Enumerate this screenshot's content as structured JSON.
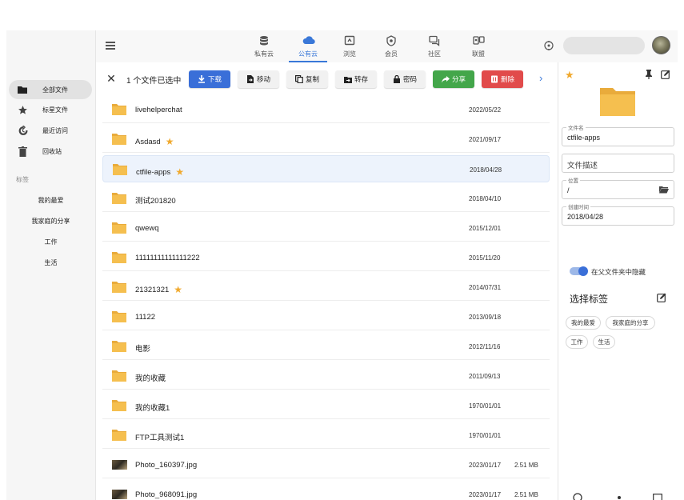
{
  "sidebar": {
    "items": [
      {
        "label": "全部文件",
        "icon": "folder-icon"
      },
      {
        "label": "标星文件",
        "icon": "star-icon"
      },
      {
        "label": "最近访问",
        "icon": "history-icon"
      },
      {
        "label": "回收站",
        "icon": "trash-icon"
      }
    ],
    "tags_title": "标签",
    "tags": [
      "我的最爱",
      "我家庭的分享",
      "工作",
      "生活"
    ]
  },
  "topbar": {
    "tabs": [
      {
        "label": "私有云",
        "icon": "database-icon"
      },
      {
        "label": "公有云",
        "icon": "cloud-icon"
      },
      {
        "label": "浏览",
        "icon": "browse-icon"
      },
      {
        "label": "会员",
        "icon": "badge-icon"
      },
      {
        "label": "社区",
        "icon": "forum-icon"
      },
      {
        "label": "联盟",
        "icon": "alliance-icon"
      }
    ],
    "active_tab": "公有云"
  },
  "actionbar": {
    "selection_text": "1 个文件已选中",
    "buttons": [
      {
        "label": "下载",
        "icon": "download-icon"
      },
      {
        "label": "移动",
        "icon": "move-icon"
      },
      {
        "label": "复制",
        "icon": "copy-icon"
      },
      {
        "label": "转存",
        "icon": "save-icon"
      },
      {
        "label": "密码",
        "icon": "lock-icon"
      },
      {
        "label": "分享",
        "icon": "share-icon"
      },
      {
        "label": "删除",
        "icon": "delete-icon"
      }
    ]
  },
  "files": [
    {
      "name": "livehelperchat",
      "date": "2022/05/22",
      "size": "",
      "starred": false,
      "type": "folder"
    },
    {
      "name": "Asdasd",
      "date": "2021/09/17",
      "size": "",
      "starred": true,
      "type": "folder"
    },
    {
      "name": "ctfile-apps",
      "date": "2018/04/28",
      "size": "",
      "starred": true,
      "type": "folder",
      "selected": true
    },
    {
      "name": "测试201820",
      "date": "2018/04/10",
      "size": "",
      "starred": false,
      "type": "folder"
    },
    {
      "name": "qwewq",
      "date": "2015/12/01",
      "size": "",
      "starred": false,
      "type": "folder"
    },
    {
      "name": "11111111111111222",
      "date": "2015/11/20",
      "size": "",
      "starred": false,
      "type": "folder"
    },
    {
      "name": "21321321",
      "date": "2014/07/31",
      "size": "",
      "starred": true,
      "type": "folder"
    },
    {
      "name": "11122",
      "date": "2013/09/18",
      "size": "",
      "starred": false,
      "type": "folder"
    },
    {
      "name": "电影",
      "date": "2012/11/16",
      "size": "",
      "starred": false,
      "type": "folder"
    },
    {
      "name": "我的收藏",
      "date": "2011/09/13",
      "size": "",
      "starred": false,
      "type": "folder"
    },
    {
      "name": "我的收藏1",
      "date": "1970/01/01",
      "size": "",
      "starred": false,
      "type": "folder"
    },
    {
      "name": "FTP工具测试1",
      "date": "1970/01/01",
      "size": "",
      "starred": false,
      "type": "folder"
    },
    {
      "name": "Photo_160397.jpg",
      "date": "2023/01/17",
      "size": "2.51 MB",
      "starred": false,
      "type": "image"
    },
    {
      "name": "Photo_968091.jpg",
      "date": "2023/01/17",
      "size": "2.51 MB",
      "starred": false,
      "type": "image"
    }
  ],
  "details": {
    "filename_label": "文件名",
    "filename": "ctfile-apps",
    "description_placeholder": "文件描述",
    "location_label": "位置",
    "location": "/",
    "created_label": "创建时间",
    "created": "2018/04/28",
    "hide_toggle_label": "在父文件夹中隐藏",
    "tags_title": "选择标签",
    "tags": [
      "我的最爱",
      "我家庭的分享",
      "工作",
      "生活"
    ]
  },
  "colors": {
    "accent": "#3a78d8",
    "folder": "#f5bf4f",
    "star": "#f0a92e",
    "share": "#43a64a",
    "delete": "#e14b4b"
  }
}
